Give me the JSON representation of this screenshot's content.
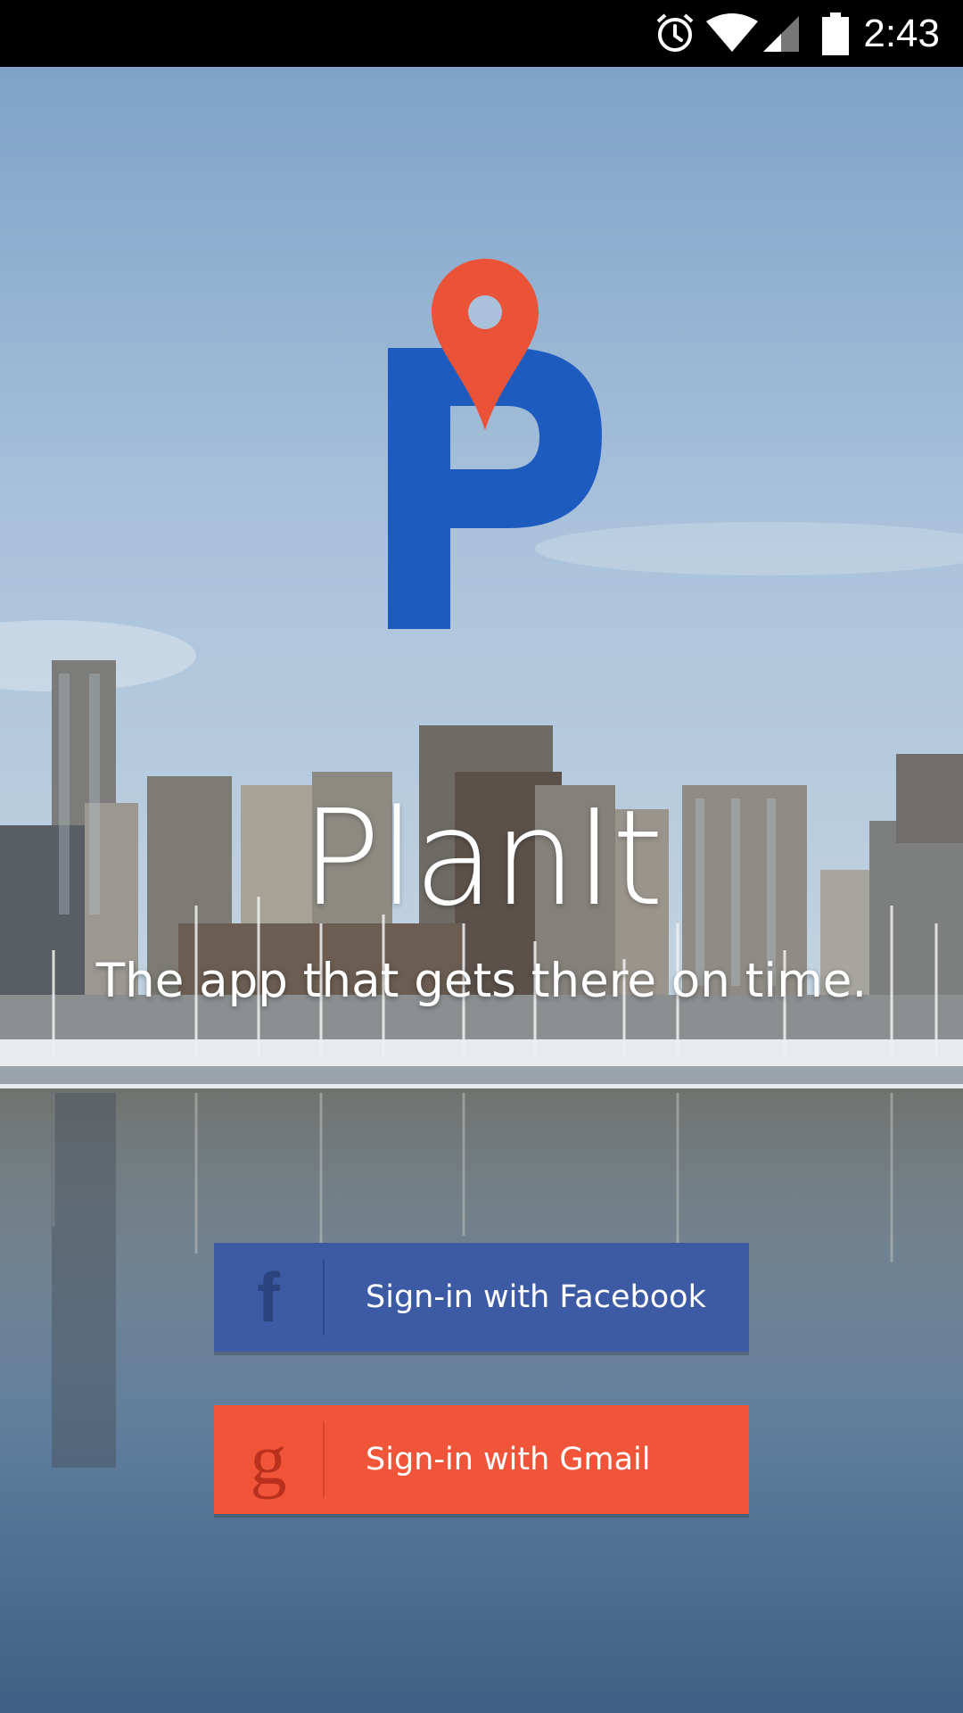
{
  "status_bar": {
    "time": "2:43",
    "icons": [
      "alarm-icon",
      "wifi-icon",
      "cell-signal-icon",
      "battery-icon"
    ]
  },
  "app": {
    "logo_icon": "planit-logo-icon",
    "title": "PlanIt",
    "tagline": "The app that gets there on time."
  },
  "buttons": {
    "facebook": {
      "icon": "facebook-icon",
      "glyph": "f",
      "label": "Sign-in with Facebook",
      "color": "#3d5ba4"
    },
    "gmail": {
      "icon": "google-icon",
      "glyph": "g",
      "label": "Sign-in with Gmail",
      "color": "#f0553a"
    }
  },
  "colors": {
    "logo_blue": "#1e5bbf",
    "pin_red": "#ea5338",
    "status_bar": "#000000"
  }
}
